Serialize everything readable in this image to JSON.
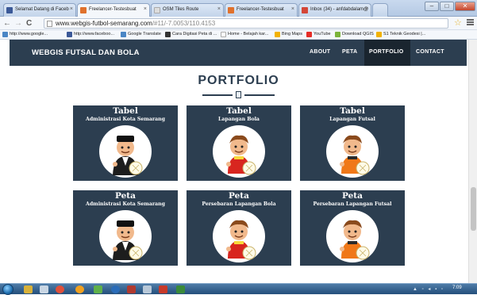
{
  "browser": {
    "tabs": [
      {
        "label": "Selamat Datang di Faceb",
        "favicon_color": "#3b5998",
        "active": false
      },
      {
        "label": "Freelancer-Testesbuat",
        "favicon_color": "#e0712c",
        "active": true
      },
      {
        "label": "OSM Tiles Route",
        "favicon_color": "#cccccc",
        "active": false
      },
      {
        "label": "Freelancer-Testesbuat",
        "favicon_color": "#e0712c",
        "active": false
      },
      {
        "label": "Inbox (34) - anfdabdalam@",
        "favicon_color": "#d44638",
        "active": false
      }
    ],
    "url_domain": "www.webgis-futbol-semarang.com",
    "url_path": "/#11/-7.0053/110.4153",
    "bookmarks": [
      {
        "label": "http://www.google...",
        "icon_color": "#4a86c5"
      },
      {
        "label": "http://www.faceboo...",
        "icon_color": "#3b5998"
      },
      {
        "label": "Google Translate",
        "icon_color": "#4a86c5"
      },
      {
        "label": "Cara Digitasi Peta di ...",
        "icon_color": "#333333"
      },
      {
        "label": "Home - Belajah kar...",
        "icon_color": "#bbbbbb"
      },
      {
        "label": "Bing Maps",
        "icon_color": "#f2b200"
      },
      {
        "label": "YouTube",
        "icon_color": "#e52d27"
      },
      {
        "label": "Download QGIS",
        "icon_color": "#7bb33a"
      },
      {
        "label": "S1 Teknik Geodesi |...",
        "icon_color": "#f2b200"
      }
    ]
  },
  "site": {
    "brand": "WEBGIS FUTSAL DAN BOLA",
    "menu": [
      "ABOUT",
      "PETA",
      "PORTFOLIO",
      "CONTACT"
    ],
    "active_menu": "PORTFOLIO",
    "section_title": "PORTFOLIO",
    "colors": {
      "primary": "#2c3e50",
      "active": "#1a252f"
    },
    "cards": [
      {
        "title": "Tabel",
        "subtitle": "Administrasi Kota Semarang",
        "figure": "official-figure-icon",
        "shirt": "#1d1d1d"
      },
      {
        "title": "Tabel",
        "subtitle": "Lapangan Bola",
        "figure": "red-footballer-icon",
        "shirt": "#d8261f"
      },
      {
        "title": "Tabel",
        "subtitle": "Lapangan Futsal",
        "figure": "orange-footballer-icon",
        "shirt": "#f07818"
      },
      {
        "title": "Peta",
        "subtitle": "Administrasi Kota Semarang",
        "figure": "official-figure-icon",
        "shirt": "#1d1d1d"
      },
      {
        "title": "Peta",
        "subtitle": "Persebaran Lapangan Bola",
        "figure": "red-footballer-icon",
        "shirt": "#d8261f"
      },
      {
        "title": "Peta",
        "subtitle": "Persebaran Lapangan Futsal",
        "figure": "orange-footballer-icon",
        "shirt": "#f07818"
      }
    ]
  },
  "taskbar": {
    "clock": "7:09"
  }
}
